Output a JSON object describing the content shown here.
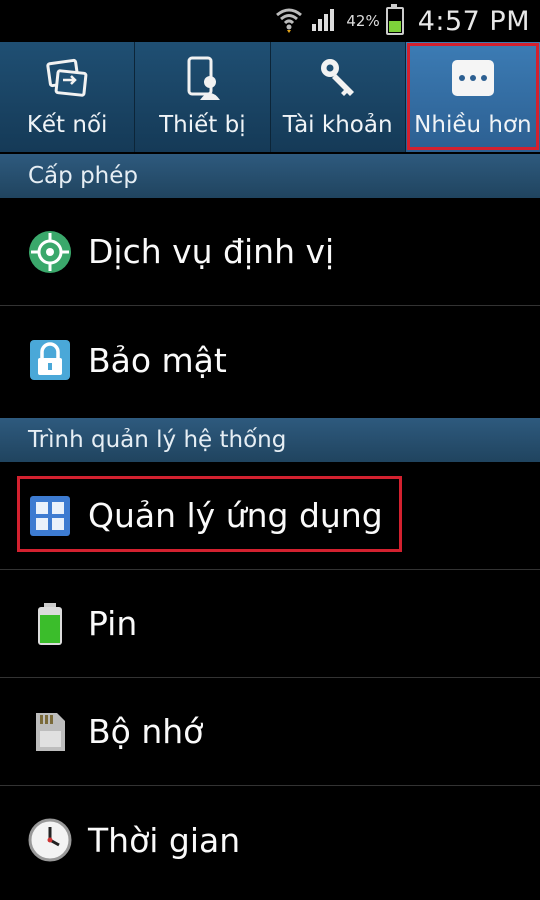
{
  "status_bar": {
    "battery_percent": "42%",
    "time": "4:57 PM"
  },
  "tabs": [
    {
      "label": "Kết nối",
      "icon": "connections-icon"
    },
    {
      "label": "Thiết bị",
      "icon": "device-icon"
    },
    {
      "label": "Tài khoản",
      "icon": "key-icon"
    },
    {
      "label": "Nhiều hơn",
      "icon": "more-icon",
      "selected": true
    }
  ],
  "sections": [
    {
      "header": "Cấp phép",
      "items": [
        {
          "label": "Dịch vụ định vị",
          "icon": "location-icon"
        },
        {
          "label": "Bảo mật",
          "icon": "lock-icon"
        }
      ]
    },
    {
      "header": "Trình quản lý hệ thống",
      "items": [
        {
          "label": "Quản lý ứng dụng",
          "icon": "app-manager-icon",
          "highlighted": true
        },
        {
          "label": "Pin",
          "icon": "battery-icon"
        },
        {
          "label": "Bộ nhớ",
          "icon": "storage-icon"
        },
        {
          "label": "Thời gian",
          "icon": "clock-icon"
        }
      ]
    }
  ],
  "colors": {
    "highlight": "#d3212f",
    "tab_bar": "#1f4f73",
    "selected_tab": "#3c7cb5"
  }
}
